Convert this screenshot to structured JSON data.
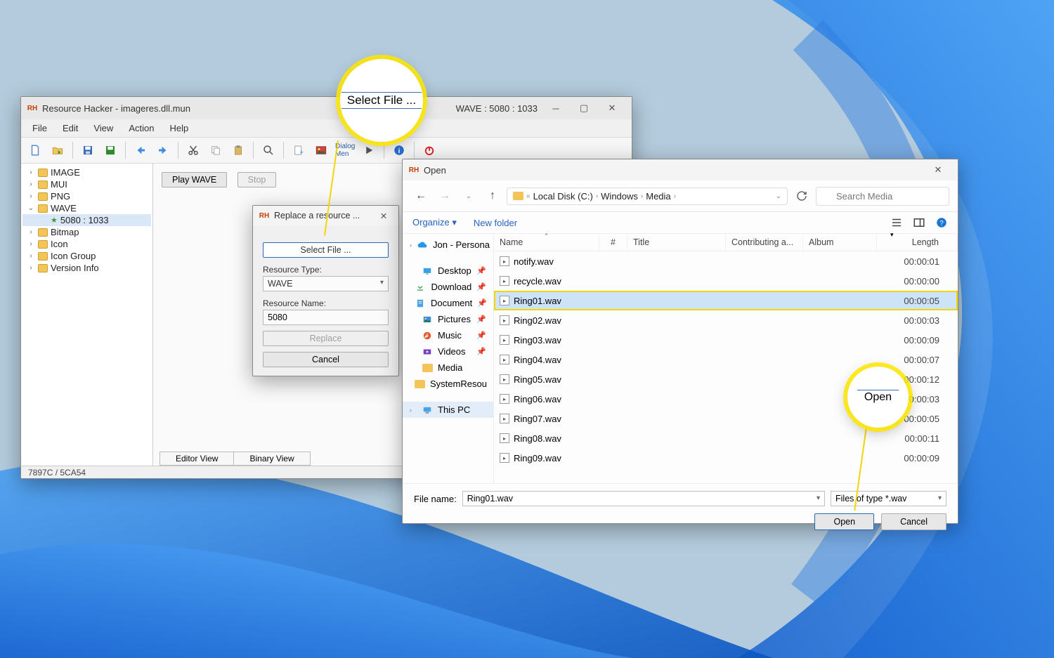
{
  "rh": {
    "title": "Resource Hacker - imageres.dll.mun",
    "status_right": "WAVE : 5080 : 1033",
    "menus": [
      "File",
      "Edit",
      "View",
      "Action",
      "Help"
    ],
    "tree": [
      {
        "label": "IMAGE",
        "level": 0,
        "expanded": false
      },
      {
        "label": "MUI",
        "level": 0,
        "expanded": false
      },
      {
        "label": "PNG",
        "level": 0,
        "expanded": false
      },
      {
        "label": "WAVE",
        "level": 0,
        "expanded": true
      },
      {
        "label": "5080 : 1033",
        "level": 1,
        "star": true,
        "selected": true
      },
      {
        "label": "Bitmap",
        "level": 0,
        "expanded": false
      },
      {
        "label": "Icon",
        "level": 0,
        "expanded": false
      },
      {
        "label": "Icon Group",
        "level": 0,
        "expanded": false
      },
      {
        "label": "Version Info",
        "level": 0,
        "expanded": false
      }
    ],
    "play_label": "Play WAVE",
    "stop_label": "Stop",
    "tabs": {
      "editor": "Editor View",
      "binary": "Binary View"
    },
    "statusbar": "7897C / 5CA54"
  },
  "replace": {
    "title": "Replace a resource ...",
    "select_file": "Select File ...",
    "type_label": "Resource Type:",
    "type_value": "WAVE",
    "name_label": "Resource Name:",
    "name_value": "5080",
    "replace_btn": "Replace",
    "cancel_btn": "Cancel"
  },
  "open": {
    "title": "Open",
    "crumbs": [
      "Local Disk (C:)",
      "Windows",
      "Media"
    ],
    "search_placeholder": "Search Media",
    "organize": "Organize",
    "new_folder": "New folder",
    "columns": {
      "name": "Name",
      "num": "#",
      "title": "Title",
      "contrib": "Contributing a...",
      "album": "Album",
      "length": "Length"
    },
    "side": [
      {
        "label": "Jon - Persona",
        "icon": "cloud",
        "caret": true
      },
      {
        "label": "Desktop",
        "icon": "desktop",
        "pin": true
      },
      {
        "label": "Download",
        "icon": "download",
        "pin": true
      },
      {
        "label": "Document",
        "icon": "doc",
        "pin": true
      },
      {
        "label": "Pictures",
        "icon": "pic",
        "pin": true
      },
      {
        "label": "Music",
        "icon": "music",
        "pin": true
      },
      {
        "label": "Videos",
        "icon": "video",
        "pin": true
      },
      {
        "label": "Media",
        "icon": "folder"
      },
      {
        "label": "SystemResou",
        "icon": "folder"
      },
      {
        "label": "This PC",
        "icon": "pc",
        "caret": true,
        "selected": true
      }
    ],
    "files": [
      {
        "name": "notify.wav",
        "length": "00:00:01"
      },
      {
        "name": "recycle.wav",
        "length": "00:00:00"
      },
      {
        "name": "Ring01.wav",
        "length": "00:00:05",
        "selected": true
      },
      {
        "name": "Ring02.wav",
        "length": "00:00:03"
      },
      {
        "name": "Ring03.wav",
        "length": "00:00:09"
      },
      {
        "name": "Ring04.wav",
        "length": "00:00:07"
      },
      {
        "name": "Ring05.wav",
        "length": "00:00:12"
      },
      {
        "name": "Ring06.wav",
        "length": "00:00:03"
      },
      {
        "name": "Ring07.wav",
        "length": "00:00:05"
      },
      {
        "name": "Ring08.wav",
        "length": "00:00:11"
      },
      {
        "name": "Ring09.wav",
        "length": "00:00:09"
      }
    ],
    "filename_label": "File name:",
    "filename_value": "Ring01.wav",
    "filter": "Files of type *.wav",
    "open_btn": "Open",
    "cancel_btn": "Cancel"
  },
  "callouts": {
    "select_file": "Select File ...",
    "open": "Open"
  }
}
